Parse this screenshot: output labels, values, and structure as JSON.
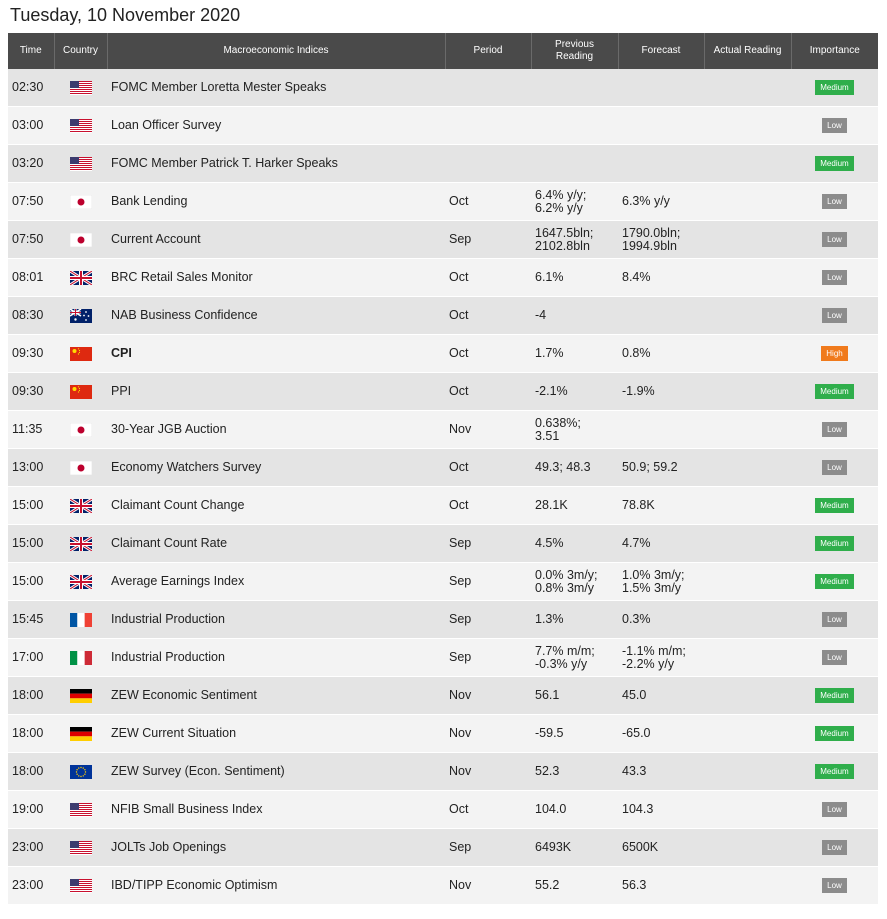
{
  "date_title": "Tuesday, 10 November 2020",
  "headers": {
    "time": "Time",
    "country": "Country",
    "indices": "Macroeconomic Indices",
    "period": "Period",
    "previous_line1": "Previous",
    "previous_line2": "Reading",
    "forecast": "Forecast",
    "actual": "Actual Reading",
    "importance": "Importance"
  },
  "flag_icons": [
    "us-flag-icon",
    "jp-flag-icon",
    "gb-flag-icon",
    "au-flag-icon",
    "cn-flag-icon",
    "fr-flag-icon",
    "it-flag-icon",
    "de-flag-icon",
    "eu-flag-icon"
  ],
  "colors": {
    "header_bg": "#4a4a4a",
    "medium": "#2fae4b",
    "low": "#8c8c8c",
    "high": "#f07a1c"
  },
  "rows": [
    {
      "time": "02:30",
      "country": "us",
      "event": "FOMC Member Loretta Mester Speaks",
      "period": "",
      "prev": [
        "",
        ""
      ],
      "fcst": [
        "",
        ""
      ],
      "actual": "",
      "importance": "Medium",
      "imp_class": "medium"
    },
    {
      "time": "03:00",
      "country": "us",
      "event": "Loan Officer Survey",
      "period": "",
      "prev": [
        "",
        ""
      ],
      "fcst": [
        "",
        ""
      ],
      "actual": "",
      "importance": "Low",
      "imp_class": "low"
    },
    {
      "time": "03:20",
      "country": "us",
      "event": "FOMC Member Patrick T. Harker Speaks",
      "period": "",
      "prev": [
        "",
        ""
      ],
      "fcst": [
        "",
        ""
      ],
      "actual": "",
      "importance": "Medium",
      "imp_class": "medium"
    },
    {
      "time": "07:50",
      "country": "jp",
      "event": "Bank Lending",
      "period": "Oct",
      "prev": [
        "6.4% y/y;",
        "6.2% y/y"
      ],
      "fcst": [
        "6.3% y/y",
        ""
      ],
      "actual": "",
      "importance": "Low",
      "imp_class": "low"
    },
    {
      "time": "07:50",
      "country": "jp",
      "event": "Current Account",
      "period": "Sep",
      "prev": [
        "1647.5bln;",
        "2102.8bln"
      ],
      "fcst": [
        "1790.0bln;",
        "1994.9bln"
      ],
      "actual": "",
      "importance": "Low",
      "imp_class": "low"
    },
    {
      "time": "08:01",
      "country": "gb",
      "event": "BRC Retail Sales Monitor",
      "period": "Oct",
      "prev": [
        "6.1%",
        ""
      ],
      "fcst": [
        "8.4%",
        ""
      ],
      "actual": "",
      "importance": "Low",
      "imp_class": "low"
    },
    {
      "time": "08:30",
      "country": "au",
      "event": "NAB Business Confidence",
      "period": "Oct",
      "prev": [
        "-4",
        ""
      ],
      "fcst": [
        "",
        ""
      ],
      "actual": "",
      "importance": "Low",
      "imp_class": "low"
    },
    {
      "time": "09:30",
      "country": "cn",
      "event": "CPI",
      "bold": true,
      "period": "Oct",
      "prev": [
        "1.7%",
        ""
      ],
      "fcst": [
        "0.8%",
        ""
      ],
      "actual": "",
      "importance": "High",
      "imp_class": "high"
    },
    {
      "time": "09:30",
      "country": "cn",
      "event": "PPI",
      "period": "Oct",
      "prev": [
        "-2.1%",
        ""
      ],
      "fcst": [
        "-1.9%",
        ""
      ],
      "actual": "",
      "importance": "Medium",
      "imp_class": "medium"
    },
    {
      "time": "11:35",
      "country": "jp",
      "event": "30-Year JGB Auction",
      "period": "Nov",
      "prev": [
        "0.638%;",
        "3.51"
      ],
      "fcst": [
        "",
        ""
      ],
      "actual": "",
      "importance": "Low",
      "imp_class": "low"
    },
    {
      "time": "13:00",
      "country": "jp",
      "event": "Economy Watchers Survey",
      "period": "Oct",
      "prev": [
        "49.3; 48.3",
        ""
      ],
      "fcst": [
        "50.9; 59.2",
        ""
      ],
      "actual": "",
      "importance": "Low",
      "imp_class": "low"
    },
    {
      "time": "15:00",
      "country": "gb",
      "event": "Claimant Count Change",
      "period": "Oct",
      "prev": [
        "28.1K",
        ""
      ],
      "fcst": [
        "78.8K",
        ""
      ],
      "actual": "",
      "importance": "Medium",
      "imp_class": "medium"
    },
    {
      "time": "15:00",
      "country": "gb",
      "event": "Claimant Count Rate",
      "period": "Sep",
      "prev": [
        "4.5%",
        ""
      ],
      "fcst": [
        "4.7%",
        ""
      ],
      "actual": "",
      "importance": "Medium",
      "imp_class": "medium"
    },
    {
      "time": "15:00",
      "country": "gb",
      "event": "Average Earnings Index",
      "period": "Sep",
      "prev": [
        "0.0% 3m/y;",
        "0.8% 3m/y"
      ],
      "fcst": [
        "1.0% 3m/y;",
        "1.5% 3m/y"
      ],
      "actual": "",
      "importance": "Medium",
      "imp_class": "medium"
    },
    {
      "time": "15:45",
      "country": "fr",
      "event": "Industrial Production",
      "period": "Sep",
      "prev": [
        "1.3%",
        ""
      ],
      "fcst": [
        "0.3%",
        ""
      ],
      "actual": "",
      "importance": "Low",
      "imp_class": "low"
    },
    {
      "time": "17:00",
      "country": "it",
      "event": "Industrial Production",
      "period": "Sep",
      "prev": [
        "7.7% m/m;",
        "-0.3% y/y"
      ],
      "fcst": [
        "-1.1% m/m;",
        "-2.2% y/y"
      ],
      "actual": "",
      "importance": "Low",
      "imp_class": "low"
    },
    {
      "time": "18:00",
      "country": "de",
      "event": "ZEW Economic Sentiment",
      "period": "Nov",
      "prev": [
        "56.1",
        ""
      ],
      "fcst": [
        "45.0",
        ""
      ],
      "actual": "",
      "importance": "Medium",
      "imp_class": "medium"
    },
    {
      "time": "18:00",
      "country": "de",
      "event": "ZEW Current Situation",
      "period": "Nov",
      "prev": [
        "-59.5",
        ""
      ],
      "fcst": [
        "-65.0",
        ""
      ],
      "actual": "",
      "importance": "Medium",
      "imp_class": "medium"
    },
    {
      "time": "18:00",
      "country": "eu",
      "event": "ZEW Survey (Econ. Sentiment)",
      "period": "Nov",
      "prev": [
        "52.3",
        ""
      ],
      "fcst": [
        "43.3",
        ""
      ],
      "actual": "",
      "importance": "Medium",
      "imp_class": "medium"
    },
    {
      "time": "19:00",
      "country": "us",
      "event": "NFIB Small Business Index",
      "period": "Oct",
      "prev": [
        "104.0",
        ""
      ],
      "fcst": [
        "104.3",
        ""
      ],
      "actual": "",
      "importance": "Low",
      "imp_class": "low"
    },
    {
      "time": "23:00",
      "country": "us",
      "event": "JOLTs Job Openings",
      "period": "Sep",
      "prev": [
        "6493K",
        ""
      ],
      "fcst": [
        "6500K",
        ""
      ],
      "actual": "",
      "importance": "Low",
      "imp_class": "low"
    },
    {
      "time": "23:00",
      "country": "us",
      "event": "IBD/TIPP Economic Optimism",
      "period": "Nov",
      "prev": [
        "55.2",
        ""
      ],
      "fcst": [
        "56.3",
        ""
      ],
      "actual": "",
      "importance": "Low",
      "imp_class": "low"
    }
  ]
}
